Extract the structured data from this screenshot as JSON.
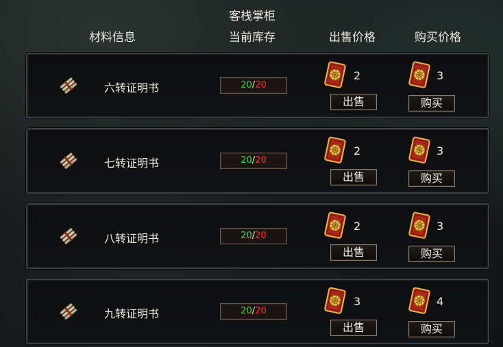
{
  "header": {
    "shop_name": "客栈掌柜",
    "col_material": "材料信息",
    "col_stock": "当前库存",
    "col_sell": "出售价格",
    "col_buy": "购买价格"
  },
  "colors": {
    "stock_current": "#2ee02e",
    "stock_max": "#ff2b2b",
    "panel_border": "#3c3f42"
  },
  "items": [
    {
      "name": "六转证明书",
      "stock_current": "20",
      "stock_sep": "/",
      "stock_max": "20",
      "sell_price": "2",
      "buy_price": "3",
      "sell_label": "出售",
      "buy_label": "购买",
      "icon": "scroll-icon",
      "currency_icon": "gold-token-icon"
    },
    {
      "name": "七转证明书",
      "stock_current": "20",
      "stock_sep": "/",
      "stock_max": "20",
      "sell_price": "2",
      "buy_price": "3",
      "sell_label": "出售",
      "buy_label": "购买",
      "icon": "scroll-icon",
      "currency_icon": "gold-token-icon"
    },
    {
      "name": "八转证明书",
      "stock_current": "20",
      "stock_sep": "/",
      "stock_max": "20",
      "sell_price": "2",
      "buy_price": "3",
      "sell_label": "出售",
      "buy_label": "购买",
      "icon": "scroll-icon",
      "currency_icon": "gold-token-icon"
    },
    {
      "name": "九转证明书",
      "stock_current": "20",
      "stock_sep": "/",
      "stock_max": "20",
      "sell_price": "3",
      "buy_price": "4",
      "sell_label": "出售",
      "buy_label": "购买",
      "icon": "scroll-icon",
      "currency_icon": "gold-token-icon"
    }
  ]
}
